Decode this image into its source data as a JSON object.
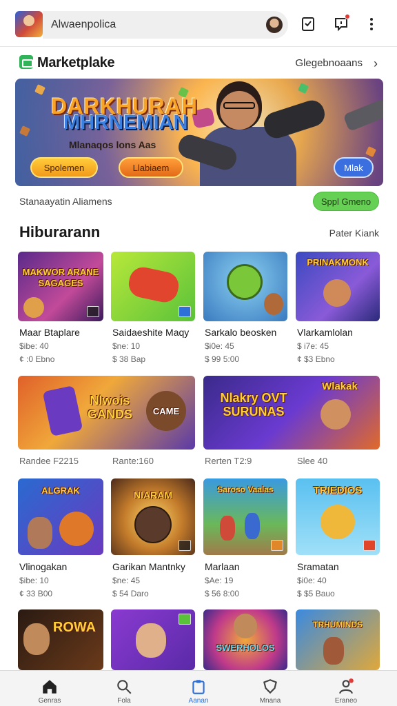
{
  "header": {
    "search_text": "Alwaenpolica"
  },
  "market": {
    "title": "Marketplake",
    "link": "Glegebnoaans",
    "chevron": "›"
  },
  "banner": {
    "title_line1": "DARKHURAH",
    "title_line2": "MHRNEMIAN",
    "subtitle": "Mlanaqos lons Aas",
    "button1": "Spolemen",
    "button2": "Llabiaem",
    "button3": "Mlak"
  },
  "status": {
    "text": "Stanaayatin Aliamens",
    "button": "Sppl Gmeno"
  },
  "section": {
    "title": "Hiburarann",
    "more": "Pater Kiank"
  },
  "row1": [
    {
      "art": "MAKWOR ARANE SAGAGES",
      "title": "Maar Btaplare",
      "price": "$ibe: 40",
      "sub": "¢ :0 Ebno"
    },
    {
      "art": "",
      "title": "Saidaeshite Maqy",
      "price": "$ne: 10",
      "sub": "$ 38 Bap"
    },
    {
      "art": "",
      "title": "Sarkalo beosken",
      "price": "$i0e: 45",
      "sub": "$ 99 5:00"
    },
    {
      "art": "PRINAKMONK",
      "title": "Vlarkamlolan",
      "price": "$ i7e: 45",
      "sub": "¢ $3 Ebno"
    }
  ],
  "row2": [
    {
      "art": "Nlwois GANDS",
      "art2": "CAME",
      "label": "Randee F2215",
      "label2": "Rante:160"
    },
    {
      "art": "Nlakry OVT SURUNAS",
      "art2": "Wlakak",
      "label": "Rerten T2:9",
      "label2": "Slee 40"
    }
  ],
  "row3": [
    {
      "art": "ALGRAK",
      "title": "Vlinogakan",
      "price": "$ibe: 10",
      "sub": "¢ 33 B00"
    },
    {
      "art": "NIARAM",
      "title": "Garikan Mantnky",
      "price": "$ne: 45",
      "sub": "$ 54 Daro"
    },
    {
      "art": "Saroso Vaalas",
      "title": "Marlaan",
      "price": "$Ae: 19",
      "sub": "$ 56 8:00"
    },
    {
      "art": "TRIEDIOS",
      "title": "Sramatan",
      "price": "$i0e: 40",
      "sub": "$ $5 Bauo"
    }
  ],
  "row4": [
    {
      "art": "ROWA"
    },
    {
      "art": ""
    },
    {
      "art": "SWERHOLOS"
    },
    {
      "art": "TRHUMINDS"
    }
  ],
  "nav": [
    {
      "label": "Genras"
    },
    {
      "label": "Fola"
    },
    {
      "label": "Aanan"
    },
    {
      "label": "Mnana"
    },
    {
      "label": "Eraneo"
    }
  ],
  "colors": {
    "accent": "#2f6fd8",
    "status_button": "#66d054",
    "notification": "#e53935"
  }
}
